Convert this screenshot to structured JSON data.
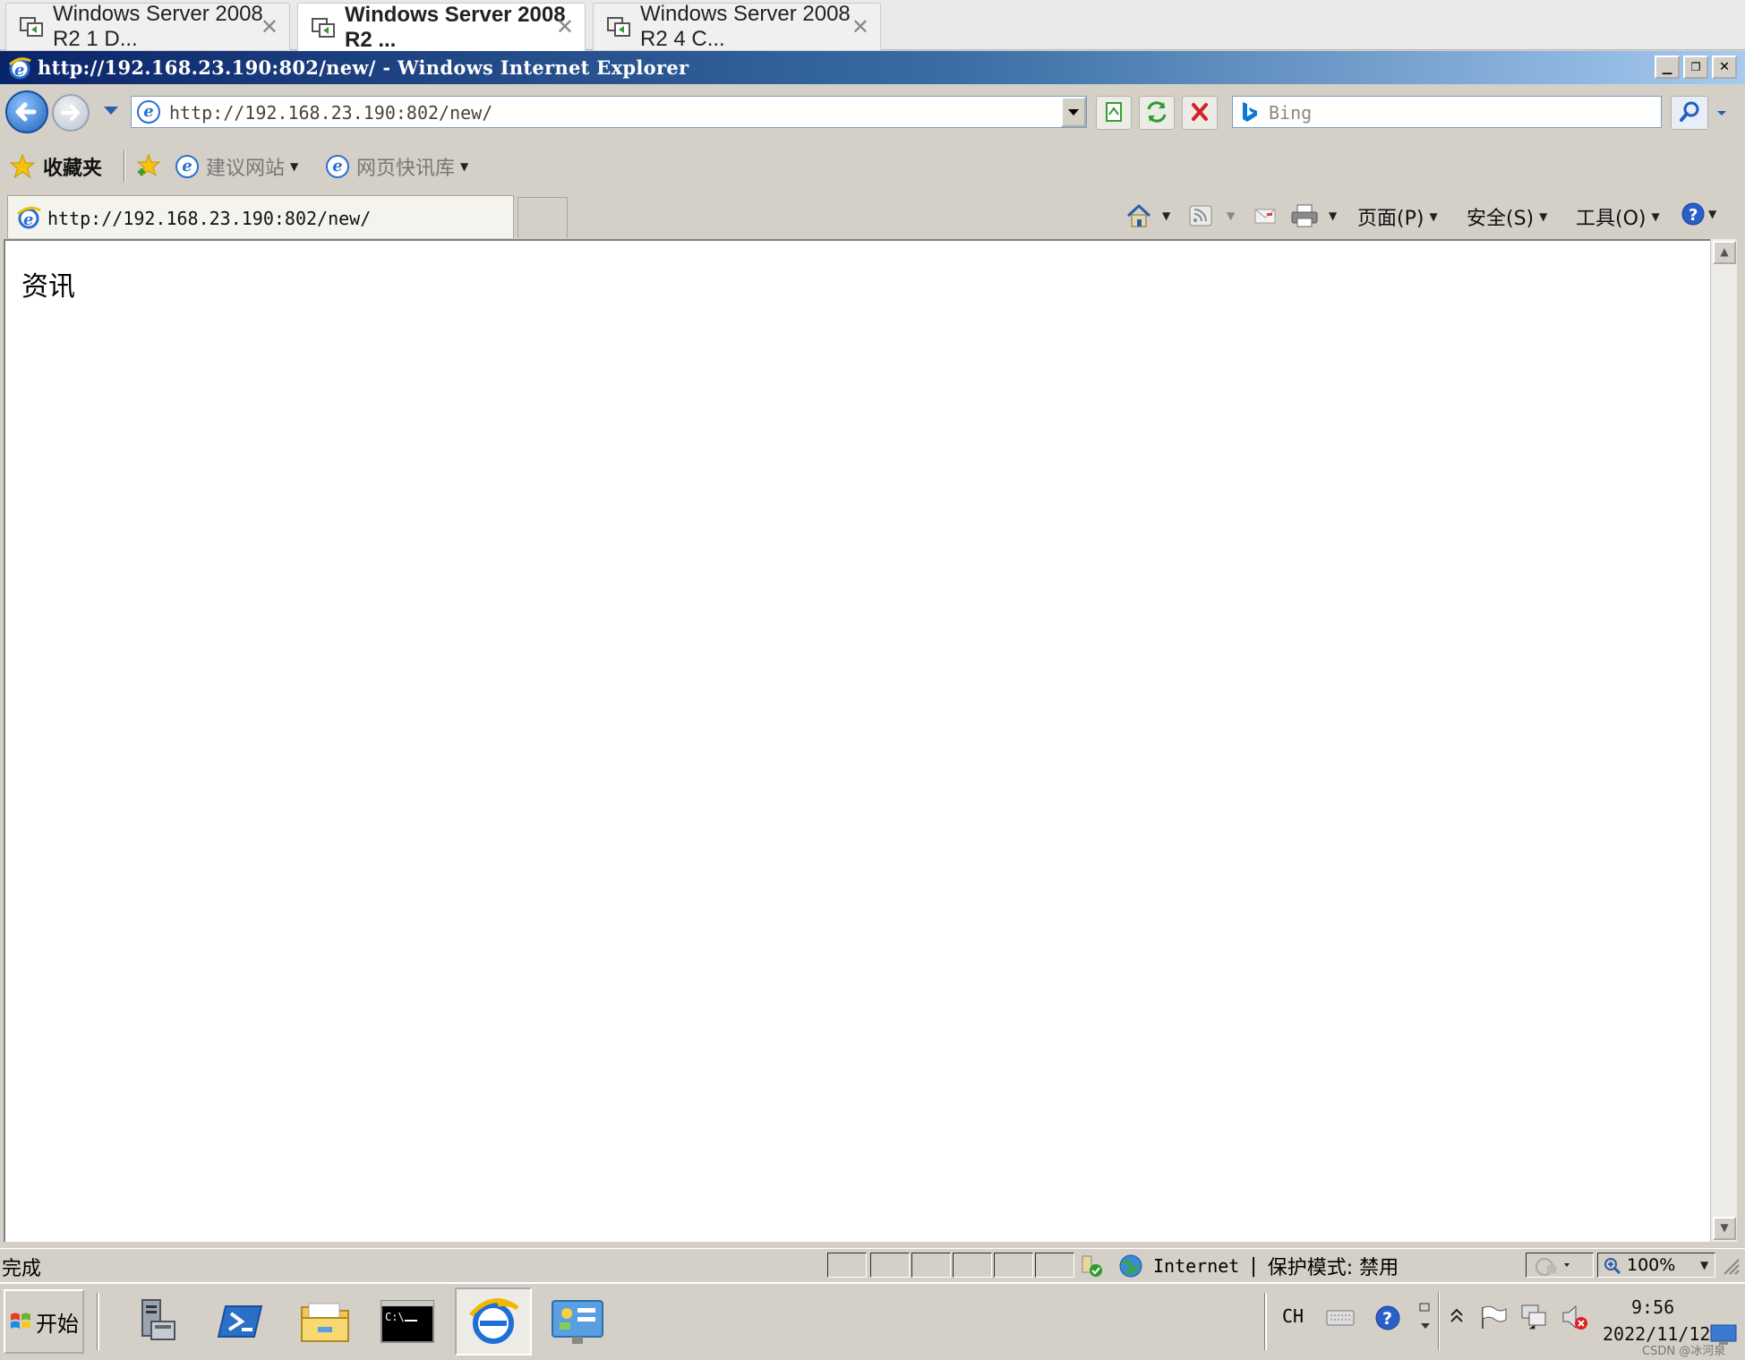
{
  "host_tabs": [
    {
      "label": "Windows Server 2008 R2 1 D...",
      "active": false
    },
    {
      "label": "Windows Server 2008 R2 ...",
      "active": true
    },
    {
      "label": "Windows Server 2008 R2 4 C...",
      "active": false
    }
  ],
  "window": {
    "title": "http://192.168.23.190:802/new/ - Windows Internet Explorer"
  },
  "address_bar": {
    "url": "http://192.168.23.190:802/new/"
  },
  "search": {
    "placeholder": "Bing"
  },
  "favorites_bar": {
    "favorites_label": "收藏夹",
    "suggested_sites": "建议网站",
    "web_slice_gallery": "网页快讯库"
  },
  "page_tab": {
    "label": "http://192.168.23.190:802/new/"
  },
  "command_bar": {
    "page": "页面(P)",
    "safety": "安全(S)",
    "tools": "工具(O)"
  },
  "content": {
    "text": "资讯"
  },
  "status_bar": {
    "status": "完成",
    "zone": "Internet",
    "protected_mode": "保护模式: 禁用",
    "zoom": "100%"
  },
  "taskbar": {
    "start_label": "开始",
    "language": "CH",
    "time": "9:56",
    "date": "2022/11/12",
    "watermark": "CSDN @冰河泉"
  },
  "colors": {
    "title_gradient_start": "#0a246a",
    "title_gradient_end": "#a6caf0",
    "chrome": "#d4d0c8",
    "ie_blue": "#2a6fcf"
  }
}
